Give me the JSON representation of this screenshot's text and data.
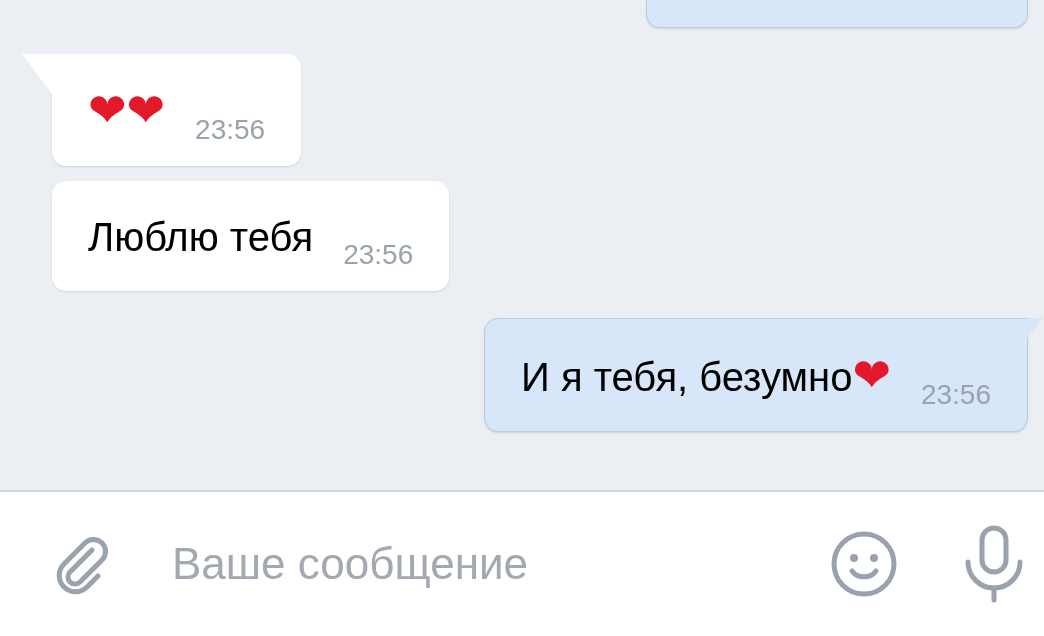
{
  "messages": [
    {
      "kind": "out",
      "cut": true
    },
    {
      "kind": "in",
      "tail": true,
      "emoji": "❤❤",
      "time": "23:56"
    },
    {
      "kind": "in",
      "tail": false,
      "text": "Люблю тебя",
      "time": "23:56"
    },
    {
      "kind": "out",
      "tail": true,
      "text": "И я тебя, безумно",
      "emoji": "❤",
      "time": "23:56"
    }
  ],
  "composer": {
    "placeholder": "Ваше сообщение"
  }
}
